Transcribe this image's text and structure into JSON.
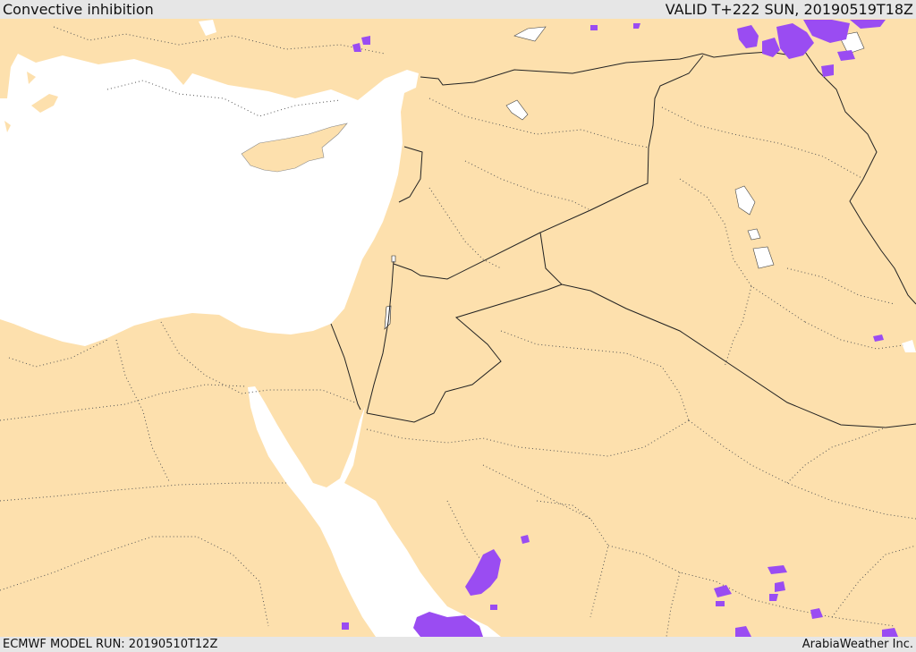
{
  "header": {
    "title": "Convective inhibition",
    "valid": "VALID T+222 SUN, 20190519T18Z"
  },
  "footer": {
    "model_run": "ECMWF MODEL RUN: 20190510T12Z",
    "credit": "ArabiaWeather Inc."
  },
  "colors": {
    "land": "#fde0ad",
    "water": "#ffffff",
    "cin_fill": "#9a4cf2",
    "border": "#222222"
  }
}
